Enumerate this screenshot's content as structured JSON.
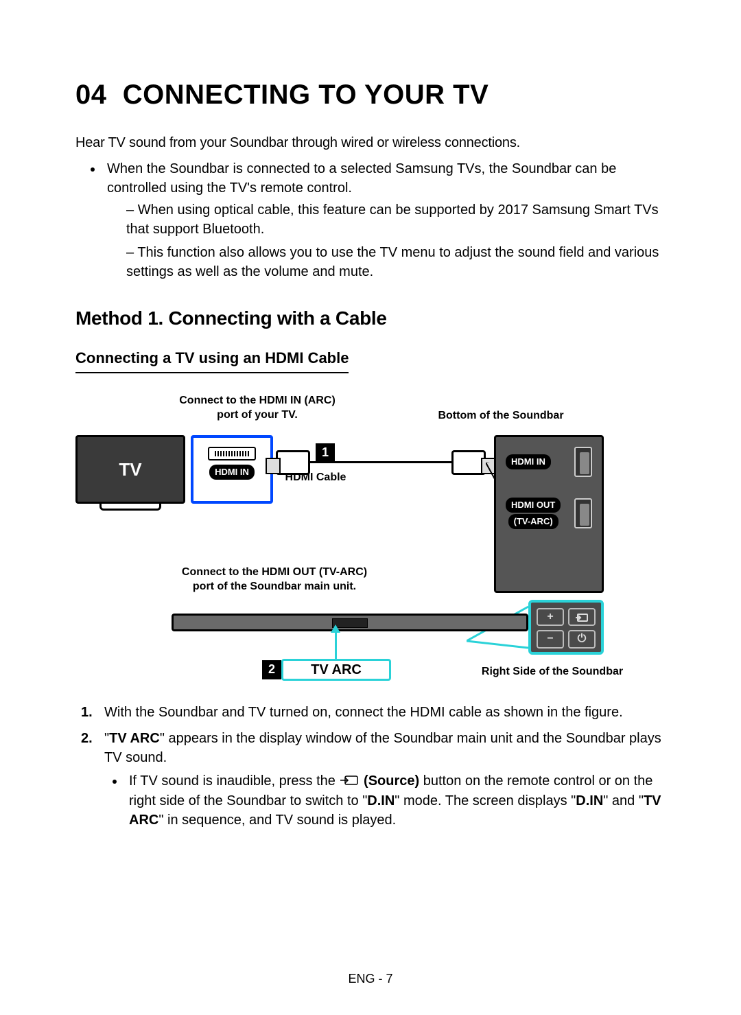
{
  "chapter_num": "04",
  "chapter_title": "CONNECTING TO YOUR TV",
  "intro": "Hear TV sound from your Soundbar through wired or wireless connections.",
  "top_bullet": "When the Soundbar is connected to a selected Samsung TVs, the Soundbar can be controlled using the TV's remote control.",
  "dash1": "When using optical cable, this feature can be supported by 2017 Samsung Smart TVs that support Bluetooth.",
  "dash2": "This function also allows you to use the TV menu to adjust the sound field and various settings as well as the volume and mute.",
  "method_heading": "Method 1. Connecting with a Cable",
  "sub_heading": "Connecting a TV using an HDMI Cable",
  "labels": {
    "connect_tv": "Connect to the HDMI IN (ARC) port of your TV.",
    "bottom_sb": "Bottom of the Soundbar",
    "hdmi_cable": "HDMI Cable",
    "connect_sb": "Connect to the HDMI OUT (TV-ARC) port of the Soundbar main unit.",
    "right_sb": "Right Side of the Soundbar",
    "tv": "TV",
    "hdmi_in_arc": "HDMI IN",
    "arc": "(ARC)",
    "hdmi_in": "HDMI IN",
    "hdmi_out": "HDMI OUT",
    "tv_arc_sub": "(TV-ARC)",
    "tv_arc": "TV ARC",
    "step1": "1",
    "step2": "2"
  },
  "steps": {
    "s1": "With the Soundbar and TV turned on, connect the HDMI cable as shown in the figure.",
    "s2_pre": "\"",
    "s2_bold1": "TV ARC",
    "s2_post": "\" appears in the display window of the Soundbar main unit and the Soundbar plays TV sound.",
    "s2_sub_pre": "If TV sound is inaudible, press the ",
    "s2_sub_source": "(Source)",
    "s2_sub_mid1": " button on the remote control or on the right side of the Soundbar to switch to \"",
    "s2_sub_din1": "D.IN",
    "s2_sub_mid2": "\" mode. The screen displays \"",
    "s2_sub_din2": "D.IN",
    "s2_sub_mid3": "\" and \"",
    "s2_sub_tvarc": "TV ARC",
    "s2_sub_end": "\" in sequence, and TV sound is played."
  },
  "footer": "ENG - 7"
}
